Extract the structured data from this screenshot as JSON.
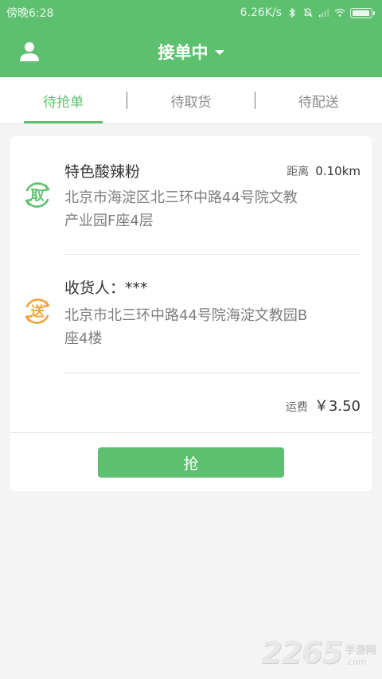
{
  "status_bar": {
    "time": "傍晚6:28",
    "net_speed": "6.26K/s"
  },
  "header": {
    "title": "接单中"
  },
  "tabs": [
    {
      "label": "待抢单",
      "active": true
    },
    {
      "label": "待取货",
      "active": false
    },
    {
      "label": "待配送",
      "active": false
    }
  ],
  "order": {
    "pickup": {
      "icon_char": "取",
      "shop_name": "特色酸辣粉",
      "distance_label": "距离",
      "distance_value": "0.10km",
      "address_line1": "北京市海淀区北三环中路44号院文教",
      "address_line2": "产业园F座4层"
    },
    "delivery": {
      "icon_char": "送",
      "receiver": "收货人：***",
      "address_line1": "北京市北三环中路44号院海淀文教园B",
      "address_line2": "座4楼"
    },
    "fee_label": "运费",
    "fee_value": "￥3.50",
    "grab_label": "抢"
  },
  "watermark": {
    "number": "2265",
    "cn": "手游网",
    "com": ".com"
  },
  "colors": {
    "brand_green": "#5dc06f",
    "pickup_icon": "#5dc06f",
    "delivery_icon": "#f2a23a"
  }
}
